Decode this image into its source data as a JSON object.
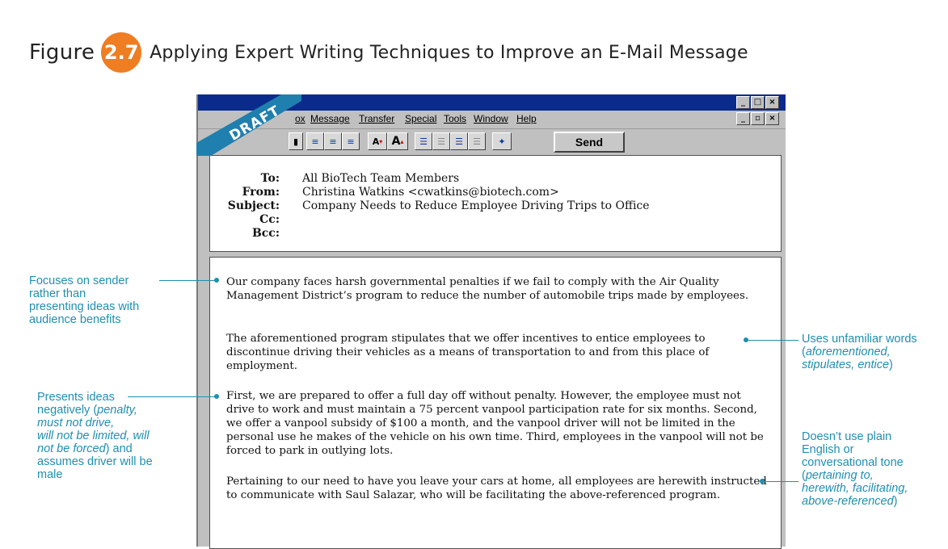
{
  "figure": {
    "word": "Figure",
    "number": "2.7",
    "caption": "Applying Expert Writing Techniques to Improve an E-Mail Message"
  },
  "ribbon": {
    "label": "DRAFT"
  },
  "window": {
    "menu": [
      "ox",
      "Message",
      "Transfer",
      "Special",
      "Tools",
      "Window",
      "Help"
    ],
    "title_controls": [
      "_",
      "□",
      "×"
    ],
    "menu_controls": [
      "_",
      "▫",
      "×"
    ],
    "toolbar": {
      "send_label": "Send",
      "font_small": "A",
      "font_large": "A"
    }
  },
  "email": {
    "to_label": "To:",
    "to": "All BioTech Team Members",
    "from_label": "From:",
    "from": "Christina Watkins <cwatkins@biotech.com>",
    "subject_label": "Subject:",
    "subject": "Company Needs to Reduce Employee Driving Trips to Office",
    "cc_label": "Cc:",
    "bcc_label": "Bcc:",
    "paragraphs": [
      "Our company faces harsh governmental penalties if we fail to comply with the Air Quality Management District’s program to reduce the number of automobile trips made by employees.",
      "The aforementioned program stipulates that we offer incentives to entice employees to discontinue driving their vehicles as a means of transportation to and from this place of employment.",
      "First, we are prepared to offer a full day off without penalty. However, the employee must not drive to work and must maintain a 75 percent vanpool participation rate for six months. Second, we offer a vanpool subsidy of $100 a month, and the vanpool driver will not be limited in the personal use he makes of the vehicle on his own time. Third, employees in the vanpool will not be forced to park in outlying lots.",
      "Pertaining to our need to have you leave your cars at home, all employees are herewith instructed to communicate with Saul Salazar, who will be facilitating the above-referenced program."
    ]
  },
  "annotations": {
    "a1": {
      "line1": "Focuses on sender",
      "line2": "rather than",
      "line3": "presenting ideas with",
      "line4": "audience benefits"
    },
    "a2": {
      "line1": "Presents ideas",
      "line2": "negatively (",
      "line2_em": "penalty,",
      "line3_em": "must not drive,",
      "line4_em": "will not be limited, will",
      "line5_em": "not be forced",
      "line5": ") and",
      "line6": "assumes driver will be",
      "line7": "male"
    },
    "a3": {
      "line1": "Uses unfamiliar words",
      "line2_open": "(",
      "line2_em": "aforementioned,",
      "line3_em": "stipulates, entice",
      "line3_close": ")"
    },
    "a4": {
      "line1": "Doesn’t use plain",
      "line2": "English or",
      "line3": "conversational tone",
      "line4_open": "(",
      "line4_em": "pertaining to,",
      "line5_em": "herewith, facilitating,",
      "line6_em": "above-referenced",
      "line6_close": ")"
    }
  },
  "colors": {
    "badge": "#ef7d22",
    "annotation": "#1f8fb0",
    "title_bar": "#0a2b8c",
    "ribbon": "#1f7fae"
  }
}
